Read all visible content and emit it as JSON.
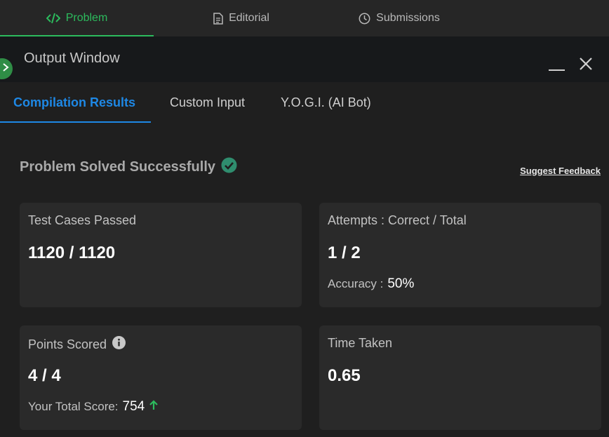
{
  "top_tabs": [
    {
      "label": "Problem",
      "icon": "code-icon",
      "active": true
    },
    {
      "label": "Editorial",
      "icon": "document-icon",
      "active": false
    },
    {
      "label": "Submissions",
      "icon": "clock-icon",
      "active": false
    }
  ],
  "output_window": {
    "title": "Output Window"
  },
  "sub_tabs": [
    {
      "label": "Compilation Results",
      "active": true
    },
    {
      "label": "Custom Input",
      "active": false
    },
    {
      "label": "Y.O.G.I. (AI Bot)",
      "active": false
    }
  ],
  "status": {
    "text": "Problem Solved Successfully",
    "icon": "check-circle-icon"
  },
  "feedback_link": "Suggest Feedback",
  "cards": {
    "test_cases": {
      "label": "Test Cases Passed",
      "value": "1120 / 1120"
    },
    "attempts": {
      "label": "Attempts : Correct / Total",
      "value": "1 / 2",
      "sub_label": "Accuracy :",
      "sub_value": "50%"
    },
    "points": {
      "label": "Points Scored",
      "value": "4 / 4",
      "sub_label": "Your Total Score:",
      "sub_value": "754",
      "info_icon": "info-icon",
      "trend_icon": "arrow-up-icon"
    },
    "time": {
      "label": "Time Taken",
      "value": "0.65"
    }
  },
  "colors": {
    "accent_green": "#2cbb5d",
    "accent_blue": "#1e88e5",
    "success_icon": "#2f8d6e",
    "card_bg": "#2a2a2a"
  }
}
